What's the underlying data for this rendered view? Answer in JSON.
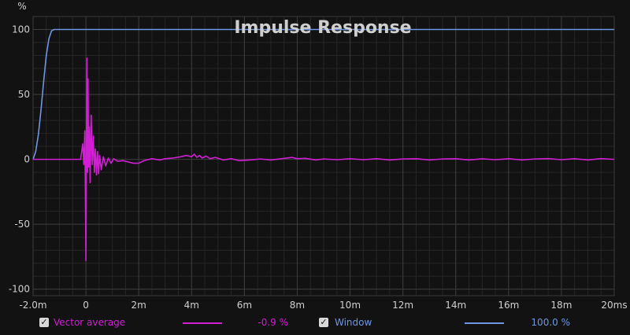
{
  "chart_data": {
    "type": "line",
    "title": "Impulse Response",
    "ylabel": "%",
    "xlim": [
      -2.0,
      20
    ],
    "ylim": [
      -105,
      110
    ],
    "x_ticks": [
      {
        "v": -2.0,
        "label": "-2.0m"
      },
      {
        "v": 0,
        "label": "0"
      },
      {
        "v": 2,
        "label": "2m"
      },
      {
        "v": 4,
        "label": "4m"
      },
      {
        "v": 6,
        "label": "6m"
      },
      {
        "v": 8,
        "label": "8m"
      },
      {
        "v": 10,
        "label": "10m"
      },
      {
        "v": 12,
        "label": "12m"
      },
      {
        "v": 14,
        "label": "14m"
      },
      {
        "v": 16,
        "label": "16m"
      },
      {
        "v": 18,
        "label": "18m"
      },
      {
        "v": 20,
        "label": "20ms"
      }
    ],
    "y_ticks": [
      {
        "v": 100,
        "label": "100"
      },
      {
        "v": 50,
        "label": "50"
      },
      {
        "v": 0,
        "label": "0"
      },
      {
        "v": -50,
        "label": "-50"
      },
      {
        "v": -100,
        "label": "-100"
      }
    ],
    "grid": true,
    "series": [
      {
        "name": "Vector average",
        "color": "#d21fd6",
        "value_label": "-0.9 %",
        "points": [
          [
            -2.0,
            0
          ],
          [
            -0.2,
            0
          ],
          [
            -0.12,
            12
          ],
          [
            -0.08,
            -4
          ],
          [
            -0.04,
            22
          ],
          [
            -0.02,
            -25
          ],
          [
            0,
            -78
          ],
          [
            0.02,
            10
          ],
          [
            0.04,
            78
          ],
          [
            0.06,
            -10
          ],
          [
            0.08,
            62
          ],
          [
            0.1,
            -6
          ],
          [
            0.13,
            25
          ],
          [
            0.16,
            -18
          ],
          [
            0.2,
            34
          ],
          [
            0.24,
            -4
          ],
          [
            0.28,
            18
          ],
          [
            0.32,
            -10
          ],
          [
            0.36,
            8
          ],
          [
            0.4,
            -12
          ],
          [
            0.44,
            6
          ],
          [
            0.48,
            -11
          ],
          [
            0.52,
            3
          ],
          [
            0.58,
            -8
          ],
          [
            0.66,
            2
          ],
          [
            0.75,
            -5
          ],
          [
            0.85,
            1
          ],
          [
            0.95,
            -3
          ],
          [
            1.05,
            0.5
          ],
          [
            1.2,
            -1.5
          ],
          [
            1.4,
            -1
          ],
          [
            1.6,
            -2
          ],
          [
            1.8,
            -3
          ],
          [
            2.0,
            -3
          ],
          [
            2.2,
            -1
          ],
          [
            2.5,
            0.5
          ],
          [
            2.8,
            -0.5
          ],
          [
            3.0,
            0.5
          ],
          [
            3.3,
            1
          ],
          [
            3.6,
            2
          ],
          [
            3.8,
            3
          ],
          [
            4.0,
            2
          ],
          [
            4.1,
            4
          ],
          [
            4.2,
            1.5
          ],
          [
            4.3,
            3
          ],
          [
            4.4,
            1
          ],
          [
            4.55,
            2.5
          ],
          [
            4.7,
            0.5
          ],
          [
            4.9,
            1.5
          ],
          [
            5.2,
            -0.5
          ],
          [
            5.5,
            0.5
          ],
          [
            5.8,
            -1
          ],
          [
            6.2,
            -0.5
          ],
          [
            6.6,
            0.3
          ],
          [
            7.0,
            -0.5
          ],
          [
            7.4,
            0.5
          ],
          [
            7.8,
            1.5
          ],
          [
            8.0,
            0.5
          ],
          [
            8.3,
            0.8
          ],
          [
            8.7,
            -0.5
          ],
          [
            9.0,
            0.3
          ],
          [
            9.5,
            -0.3
          ],
          [
            10.0,
            0.5
          ],
          [
            10.5,
            -0.3
          ],
          [
            11.0,
            0.5
          ],
          [
            11.5,
            -0.5
          ],
          [
            12.0,
            0.3
          ],
          [
            12.5,
            0.5
          ],
          [
            13.0,
            -0.5
          ],
          [
            13.5,
            0.3
          ],
          [
            14.0,
            0.5
          ],
          [
            14.5,
            -0.5
          ],
          [
            15.0,
            0.4
          ],
          [
            15.5,
            -0.3
          ],
          [
            16.0,
            0.5
          ],
          [
            16.5,
            -0.5
          ],
          [
            17.0,
            0.3
          ],
          [
            17.5,
            0.6
          ],
          [
            18.0,
            -0.3
          ],
          [
            18.5,
            0.5
          ],
          [
            19.0,
            -0.5
          ],
          [
            19.5,
            0.6
          ],
          [
            20.0,
            0
          ]
        ]
      },
      {
        "name": "Window",
        "color": "#6f96e3",
        "value_label": "100.0 %",
        "points": [
          [
            -2.0,
            0
          ],
          [
            -1.9,
            6
          ],
          [
            -1.8,
            19
          ],
          [
            -1.7,
            38
          ],
          [
            -1.6,
            60
          ],
          [
            -1.5,
            80
          ],
          [
            -1.4,
            93
          ],
          [
            -1.3,
            99
          ],
          [
            -1.2,
            100
          ],
          [
            20,
            100
          ]
        ]
      }
    ]
  }
}
